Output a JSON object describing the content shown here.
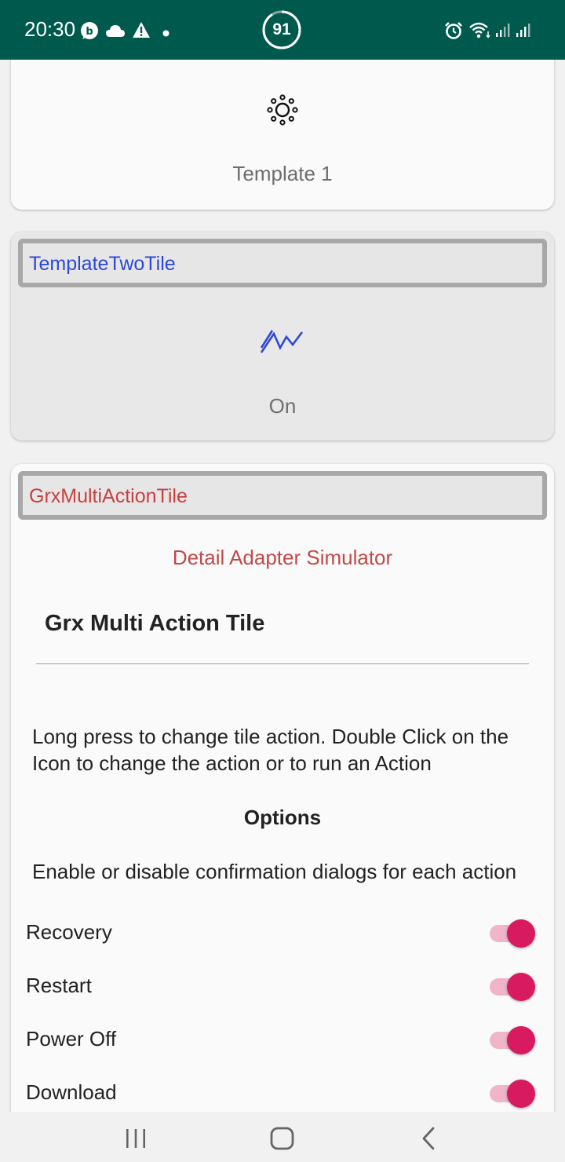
{
  "status_bar": {
    "time": "20:30",
    "battery": "91",
    "icons": [
      "whatsapp-business-icon",
      "cloud-icon",
      "warning-icon",
      "dot-icon",
      "alarm-icon",
      "wifi-icon",
      "signal-icon",
      "signal-icon"
    ]
  },
  "tiles": {
    "template_one": {
      "icon": "brightness-icon",
      "label": "Template 1"
    },
    "template_two": {
      "title": "TemplateTwoTile",
      "icon": "activity-icon",
      "label": "On"
    },
    "multi_action": {
      "title": "GrxMultiActionTile",
      "detail_link": "Detail Adapter Simulator",
      "heading": "Grx Multi Action Tile",
      "description": "Long press to change tile action. Double Click on the Icon to change the action or to run an Action",
      "options_heading": "Options",
      "options_description": "Enable or disable confirmation dialogs for each action",
      "switches": [
        {
          "label": "Recovery",
          "enabled": true
        },
        {
          "label": "Restart",
          "enabled": true
        },
        {
          "label": "Power Off",
          "enabled": true
        },
        {
          "label": "Download",
          "enabled": true
        }
      ]
    }
  },
  "nav_bar": {
    "icons": [
      "recents-icon",
      "home-icon",
      "back-icon"
    ]
  },
  "colors": {
    "status_bar": "#00594d",
    "accent": "#d81b60",
    "title_blue": "#2d47d8",
    "title_red": "#c84040"
  }
}
